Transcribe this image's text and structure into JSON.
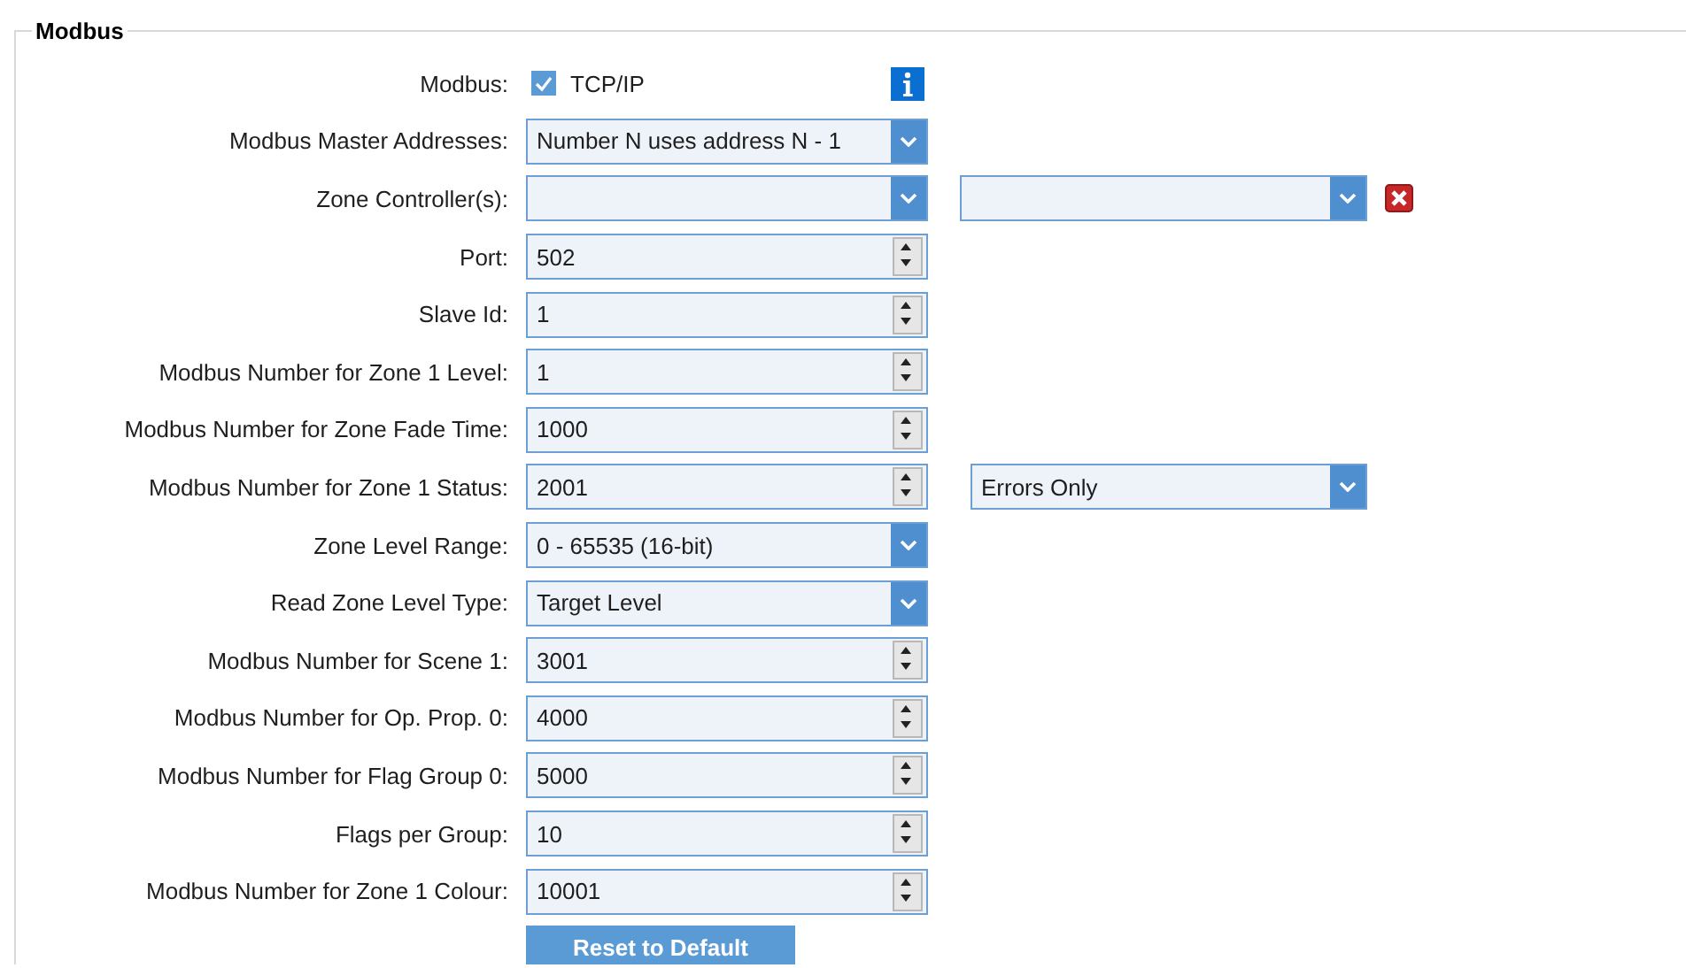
{
  "group": {
    "title": "Modbus"
  },
  "rows": [
    {
      "kind": "checkbox",
      "label": "Modbus:",
      "text": "TCP/IP",
      "checked": true
    },
    {
      "kind": "combo",
      "label": "Modbus Master Addresses:",
      "value": "Number N uses address N - 1"
    },
    {
      "kind": "combo",
      "label": "Zone Controller(s):",
      "extra": {
        "kind": "combo",
        "removable": true
      }
    },
    {
      "kind": "spin",
      "label": "Port:",
      "value": "502"
    },
    {
      "kind": "spin",
      "label": "Slave Id:",
      "value": "1"
    },
    {
      "kind": "spin",
      "label": "Modbus Number for Zone 1 Level:",
      "value": "1"
    },
    {
      "kind": "spin",
      "label": "Modbus Number for Zone Fade Time:",
      "value": "1000"
    },
    {
      "kind": "spin",
      "label": "Modbus Number for Zone 1 Status:",
      "value": "2001",
      "extra": {
        "kind": "combo",
        "value": "Errors Only",
        "removable": false
      }
    },
    {
      "kind": "combo",
      "label": "Zone Level Range:",
      "value": "0 - 65535  (16-bit)"
    },
    {
      "kind": "combo",
      "label": "Read Zone Level Type:",
      "value": "Target Level"
    },
    {
      "kind": "spin",
      "label": "Modbus Number for Scene 1:",
      "value": "3001"
    },
    {
      "kind": "spin",
      "label": "Modbus Number for Op. Prop. 0:",
      "value": "4000"
    },
    {
      "kind": "spin",
      "label": "Modbus Number for Flag Group 0:",
      "value": "5000"
    },
    {
      "kind": "spin",
      "label": "Flags per Group:",
      "value": "10"
    },
    {
      "kind": "spin",
      "label": "Modbus Number for Zone 1 Colour:",
      "value": "10001"
    }
  ],
  "reset_button": "Reset to Default"
}
